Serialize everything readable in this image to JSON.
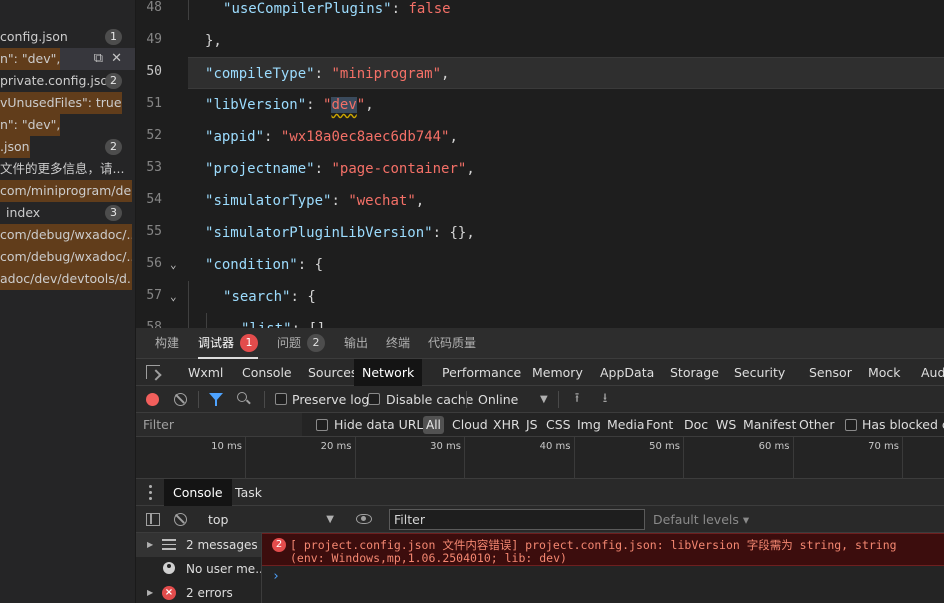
{
  "search_results": {
    "rows": [
      {
        "text": "config.json",
        "badge": "1"
      },
      {
        "text": "n\": \"dev\",",
        "selected": true
      },
      {
        "text": "private.config.json",
        "badge": "2"
      },
      {
        "text": "vUnusedFiles\": true"
      },
      {
        "text": "n\": \"dev\","
      },
      {
        "text": ".json",
        "badge": "2"
      },
      {
        "text": "文件的更多信息，请..."
      },
      {
        "text": "com/miniprogram/de..."
      },
      {
        "text": "index",
        "badge": "3"
      },
      {
        "text": "com/debug/wxadoc/..."
      },
      {
        "text": "com/debug/wxadoc/..."
      },
      {
        "text": "adoc/dev/devtools/d..."
      }
    ],
    "row_icons": {
      "copy": "⧉",
      "close": "✕"
    }
  },
  "editor": {
    "lines": [
      {
        "num": "48",
        "key": "useCompilerPlugins",
        "value": "false",
        "vtype": "bool",
        "indent": 1
      },
      {
        "num": "49",
        "raw": "},",
        "indent": 0
      },
      {
        "num": "50",
        "key": "compileType",
        "value": "miniprogram",
        "vtype": "str",
        "indent": 0,
        "current": true
      },
      {
        "num": "51",
        "key": "libVersion",
        "value": "dev",
        "vtype": "str",
        "indent": 0,
        "error": true
      },
      {
        "num": "52",
        "key": "appid",
        "value": "wx18a0ec8aec6db744",
        "vtype": "str",
        "indent": 0
      },
      {
        "num": "53",
        "key": "projectname",
        "value": "page-container",
        "vtype": "str",
        "indent": 0
      },
      {
        "num": "54",
        "key": "simulatorType",
        "value": "wechat",
        "vtype": "str",
        "indent": 0
      },
      {
        "num": "55",
        "key": "simulatorPluginLibVersion",
        "value": "{}",
        "vtype": "obj",
        "indent": 0
      },
      {
        "num": "56",
        "key": "condition",
        "value": "{",
        "vtype": "open",
        "indent": 0,
        "fold": true
      },
      {
        "num": "57",
        "key": "search",
        "value": "{",
        "vtype": "open",
        "indent": 1,
        "fold": true
      },
      {
        "num": "58",
        "key": "list",
        "value": "[]",
        "vtype": "obj",
        "indent": 2
      }
    ]
  },
  "devtools": {
    "top_tabs": [
      {
        "label": "构建"
      },
      {
        "label": "调试器",
        "count": "1",
        "active": true
      },
      {
        "label": "问题",
        "count": "2"
      },
      {
        "label": "输出"
      },
      {
        "label": "终端"
      },
      {
        "label": "代码质量"
      }
    ],
    "panel_tabs": [
      "Wxml",
      "Console",
      "Sources",
      "Network",
      "Performance",
      "Memory",
      "AppData",
      "Storage",
      "Security",
      "Sensor",
      "Mock",
      "Aud"
    ],
    "active_panel": "Network",
    "network_toolbar": {
      "preserve_log": "Preserve log",
      "disable_cache": "Disable cache",
      "throttle": "Online"
    },
    "filter_bar": {
      "placeholder": "Filter",
      "hide_data_urls": "Hide data URLs",
      "types": [
        "All",
        "Cloud",
        "XHR",
        "JS",
        "CSS",
        "Img",
        "Media",
        "Font",
        "Doc",
        "WS",
        "Manifest",
        "Other"
      ],
      "has_blocked": "Has blocked co"
    },
    "timeline_ticks": [
      "10 ms",
      "20 ms",
      "30 ms",
      "40 ms",
      "50 ms",
      "60 ms",
      "70 ms"
    ],
    "drawer_tabs": [
      {
        "label": "Console",
        "active": true
      },
      {
        "label": "Task"
      }
    ],
    "console_toolbar": {
      "context": "top",
      "filter_placeholder": "Filter",
      "levels": "Default levels ▾"
    },
    "console_sidebar": [
      {
        "label": "2 messages",
        "icon": "list-icon",
        "selected": true
      },
      {
        "label": "No user me...",
        "icon": "user-icon"
      },
      {
        "label": "2 errors",
        "icon": "error-icon"
      }
    ],
    "console_error": {
      "count": "2",
      "line1": "[ project.config.json 文件内容错误] project.config.json: libVersion 字段需为 string, string",
      "line2": "(env: Windows,mp,1.06.2504010; lib: dev)"
    },
    "prompt": "›"
  }
}
